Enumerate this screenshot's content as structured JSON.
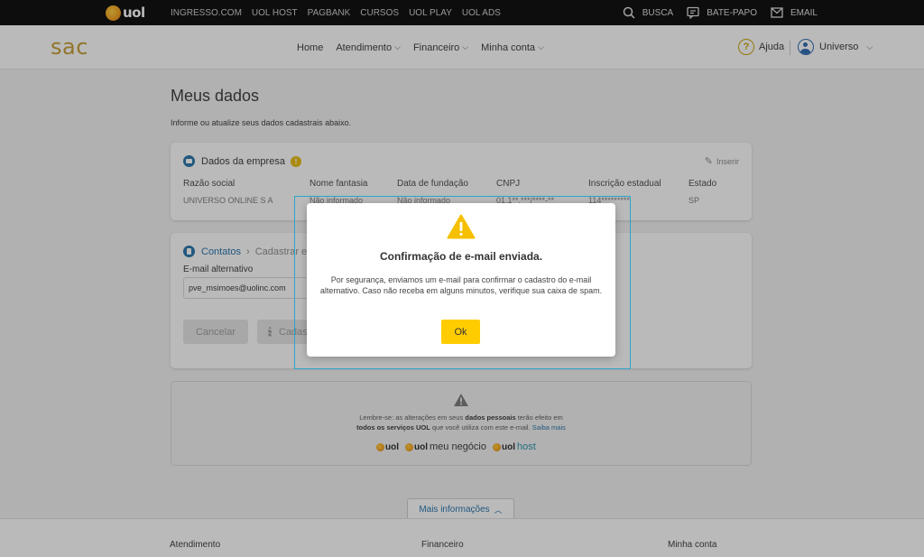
{
  "topbar": {
    "brand": "uol",
    "links": [
      "INGRESSO.COM",
      "UOL HOST",
      "PAGBANK",
      "CURSOS",
      "UOL PLAY",
      "UOL ADS"
    ],
    "search_label": "BUSCA",
    "chat_label": "BATE-PAPO",
    "email_label": "EMAIL"
  },
  "header": {
    "logo": "sac",
    "nav": [
      {
        "label": "Home",
        "dropdown": false
      },
      {
        "label": "Atendimento",
        "dropdown": true
      },
      {
        "label": "Financeiro",
        "dropdown": true
      },
      {
        "label": "Minha conta",
        "dropdown": true
      }
    ],
    "help_label": "Ajuda",
    "user_label": "Universo"
  },
  "main": {
    "title": "Meus dados",
    "subtitle": "Informe ou atualize seus dados cadastrais abaixo.",
    "company": {
      "heading": "Dados da empresa",
      "insert_label": "Inserir",
      "columns": [
        {
          "header": "Razão social",
          "value": "UNIVERSO ONLINE S A"
        },
        {
          "header": "Nome fantasia",
          "value": "Não informado"
        },
        {
          "header": "Data de fundação",
          "value": "Não informado"
        },
        {
          "header": "CNPJ",
          "value": "01.1**.***/****-**"
        },
        {
          "header": "Inscrição estadual",
          "value": "114*********"
        },
        {
          "header": "Estado",
          "value": "SP"
        }
      ]
    },
    "contacts": {
      "crumb_1": "Contatos",
      "crumb_2": "Cadastrar e-mail",
      "email_label": "E-mail alternativo",
      "email_value": "pve_msimoes@uolinc.com",
      "cancel_label": "Cancelar",
      "save_label": "Cadastrar"
    },
    "notice": {
      "text_1": "Lembre-se: as alterações em seus ",
      "bold_1": "dados pessoais",
      "text_2": " terão efeito em",
      "bold_2": "todos os serviços UOL",
      "text_3": " que você utiliza com este e-mail. ",
      "link": "Saiba mais",
      "brands": [
        {
          "word": "uol",
          "suffix": ""
        },
        {
          "word": "uol",
          "suffix": "meu negócio"
        },
        {
          "word": "uol",
          "suffix": "host"
        }
      ]
    },
    "more_info_label": "Mais informações"
  },
  "footer": {
    "cols": [
      "Atendimento",
      "Financeiro",
      "Minha conta"
    ]
  },
  "modal": {
    "title": "Confirmação de e-mail enviada.",
    "message": "Por segurança, enviamos um e-mail para confirmar o cadastro do e-mail alternativo. Caso não receba em alguns minutos, verifique sua caixa de spam.",
    "ok_label": "Ok"
  },
  "colors": {
    "accent_yellow": "#ffcc00",
    "brand_gold": "#c49a2c",
    "link_blue": "#1e6fa8",
    "focus_ring": "#2aa6c8"
  }
}
